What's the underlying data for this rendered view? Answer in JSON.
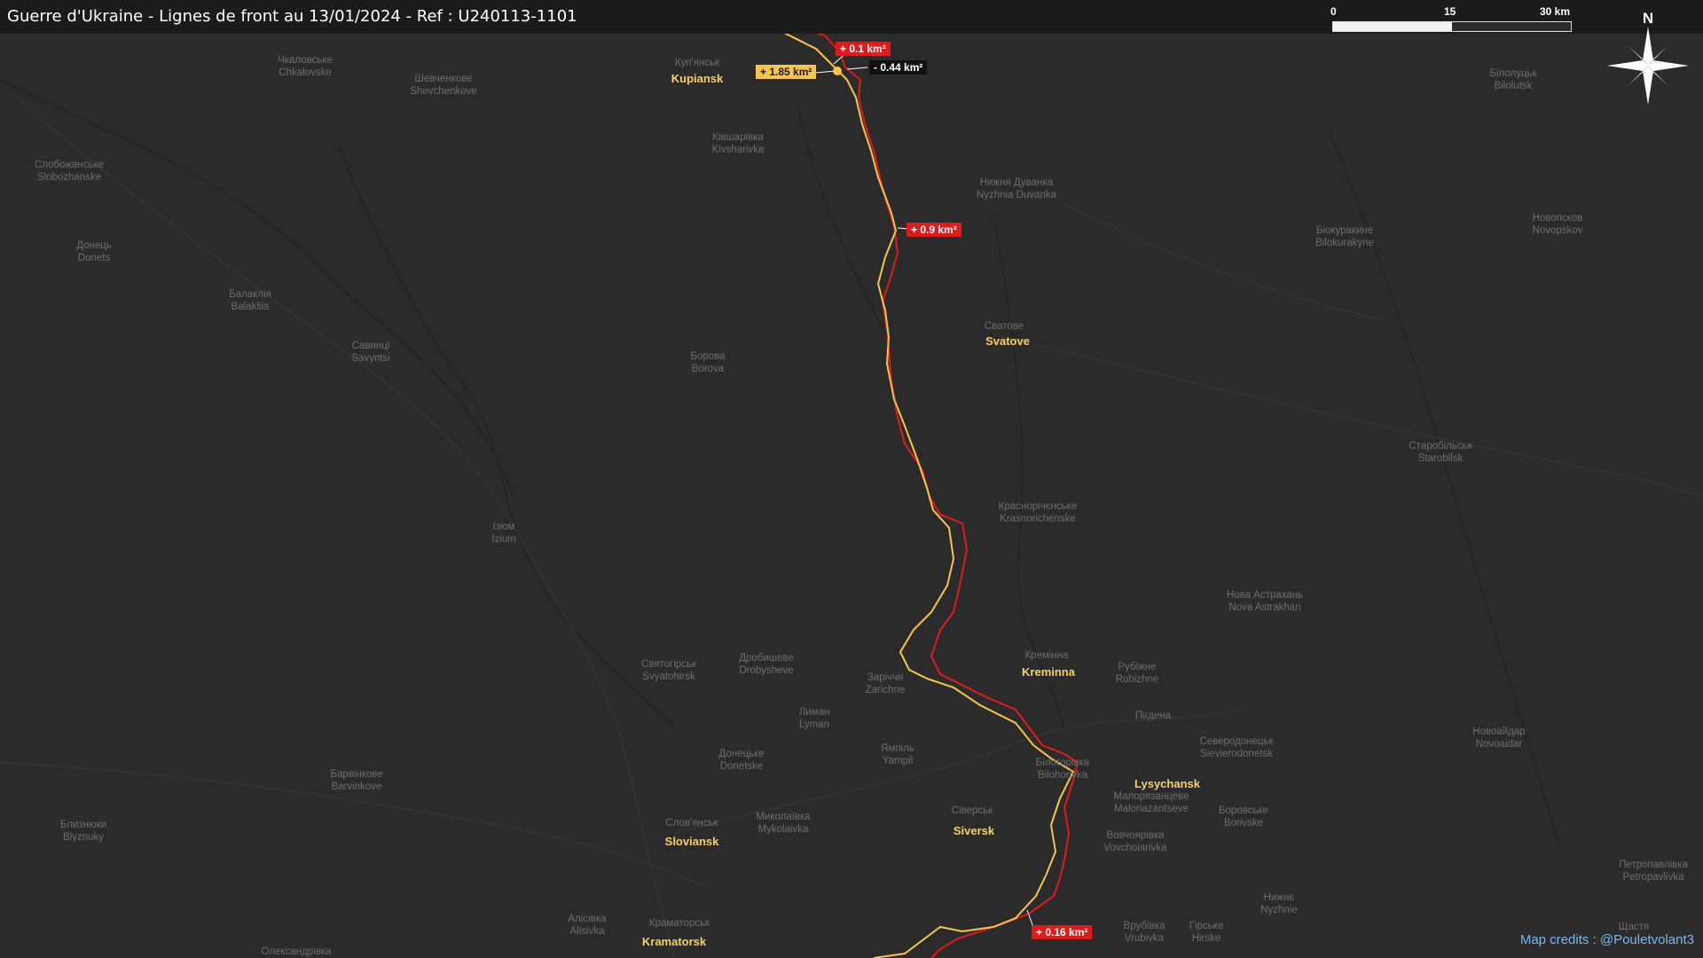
{
  "header": {
    "title": "Guerre d'Ukraine - Lignes de front au 13/01/2024 - Ref : U240113-1101"
  },
  "scale_bar": {
    "ticks": [
      "0",
      "15",
      "30 km"
    ]
  },
  "compass": {
    "label": "N",
    "icon": "north-arrow-icon"
  },
  "credits": "Map credits : @Pouletvolant3",
  "colors": {
    "russian_line": "#e01b1b",
    "ukrainian_line": "#f5c64a",
    "background": "#2b2b2b"
  },
  "cities": [
    {
      "name": "Kupiansk"
    },
    {
      "name": "Svatove"
    },
    {
      "name": "Kreminna"
    },
    {
      "name": "Lysychansk"
    },
    {
      "name": "Siversk"
    },
    {
      "name": "Sloviansk"
    },
    {
      "name": "Kramatorsk"
    }
  ],
  "places": [
    {
      "line1": "Куп'янськ",
      "line2": ""
    },
    {
      "line1": "Чкаловське",
      "line2": "Chkalovske"
    },
    {
      "line1": "Шевченкове",
      "line2": "Shevchenkove"
    },
    {
      "line1": "Слобожанське",
      "line2": "Slobozhanske"
    },
    {
      "line1": "Донець",
      "line2": "Donets"
    },
    {
      "line1": "Балаклія",
      "line2": "Balakliia"
    },
    {
      "line1": "Савинці",
      "line2": "Savyntsi"
    },
    {
      "line1": "Ківшарівка",
      "line2": "Kivsharivka"
    },
    {
      "line1": "Нижня Дуванка",
      "line2": "Nyzhnia Duvanka"
    },
    {
      "line1": "Борова",
      "line2": "Borova"
    },
    {
      "line1": "Сватове",
      "line2": ""
    },
    {
      "line1": "Ізюм",
      "line2": "Izium"
    },
    {
      "line1": "Краснорічєнське",
      "line2": "Krasnorichenske"
    },
    {
      "line1": "Святогірськ",
      "line2": "Svyatohirsk"
    },
    {
      "line1": "Дробишеве",
      "line2": "Drobysheve"
    },
    {
      "line1": "Заріччя",
      "line2": "Zarichne"
    },
    {
      "line1": "Кремінна",
      "line2": ""
    },
    {
      "line1": "Рубіжне",
      "line2": "Rubizhne"
    },
    {
      "line1": "Лиман",
      "line2": "Lyman"
    },
    {
      "line1": "Донецьке",
      "line2": "Donetske"
    },
    {
      "line1": "Ямпіль",
      "line2": "Yampil"
    },
    {
      "line1": "Білогорівка",
      "line2": "Bilohorivka"
    },
    {
      "line1": "Сіверськ",
      "line2": ""
    },
    {
      "line1": "Слов'янськ",
      "line2": ""
    },
    {
      "line1": "Миколаївка",
      "line2": "Mykolaivka"
    },
    {
      "line1": "Барвінкове",
      "line2": "Barvinkove"
    },
    {
      "line1": "Близнюки",
      "line2": "Blyznuky"
    },
    {
      "line1": "Краматорськ",
      "line2": ""
    },
    {
      "line1": "Алісівка",
      "line2": "Alisivka"
    },
    {
      "line1": "Олександрівка",
      "line2": ""
    },
    {
      "line1": "Пігдена",
      "line2": ""
    },
    {
      "line1": "Северодонецьк",
      "line2": "Sievierodonetsk"
    },
    {
      "line1": "Малорязанцеве",
      "line2": "Maloriazantseve"
    },
    {
      "line1": "Вовчоярівка",
      "line2": "Vovchoiarivka"
    },
    {
      "line1": "Боровське",
      "line2": "Borivske"
    },
    {
      "line1": "Врубівка",
      "line2": "Vrubivka"
    },
    {
      "line1": "Гірське",
      "line2": "Hirske"
    },
    {
      "line1": "Нижнє",
      "line2": "Nyzhnie"
    },
    {
      "line1": "Нова Астрахань",
      "line2": "Nova Astrakhan"
    },
    {
      "line1": "Новоайдар",
      "line2": "Novoaidar"
    },
    {
      "line1": "Старобільськ",
      "line2": "Starobilsk"
    },
    {
      "line1": "Біокуракине",
      "line2": "Bilokurakyne"
    },
    {
      "line1": "Новопсков",
      "line2": "Novopskov"
    },
    {
      "line1": "Білолуцьк",
      "line2": "Bilolutsk"
    },
    {
      "line1": "Петропавлівка",
      "line2": "Petropavlivka"
    },
    {
      "line1": "Щастя",
      "line2": ""
    }
  ],
  "area_changes": [
    {
      "text": "+ 0.1 km²",
      "kind": "red"
    },
    {
      "text": "+ 1.85 km²",
      "kind": "yellow"
    },
    {
      "text": "- 0.44 km²",
      "kind": "black"
    },
    {
      "text": "+ 0.9 km²",
      "kind": "red"
    },
    {
      "text": "+ 0.16 km²",
      "kind": "red"
    }
  ]
}
